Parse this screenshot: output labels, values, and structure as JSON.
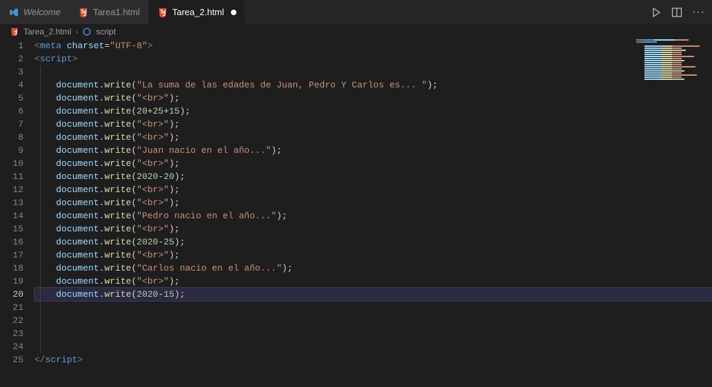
{
  "tabs": {
    "welcome": "Welcome",
    "tarea1": "Tarea1.html",
    "tarea2": "Tarea_2.html"
  },
  "breadcrumb": {
    "file": "Tarea_2.html",
    "symbol": "script"
  },
  "editor_actions": {
    "run": "Run",
    "split": "Split Editor",
    "more": "More Actions"
  },
  "active_line": 20,
  "total_lines": 25,
  "code": {
    "l1": {
      "tag_open": "<",
      "tag_name": "meta",
      "attr": "charset",
      "eq": "=",
      "val": "\"UTF-8\"",
      "tag_close": ">"
    },
    "l2": {
      "open": "<",
      "name": "script",
      "close": ">"
    },
    "l4": {
      "obj": "document",
      "dot": ".",
      "fn": "write",
      "op": "(",
      "str": "\"La suma de las edades de Juan, Pedro Y Carlos es... \"",
      "cp": ")",
      "semi": ";"
    },
    "l5": {
      "obj": "document",
      "dot": ".",
      "fn": "write",
      "op": "(",
      "str": "\"<br>\"",
      "cp": ")",
      "semi": ";"
    },
    "l6": {
      "obj": "document",
      "dot": ".",
      "fn": "write",
      "op": "(",
      "n1": "20",
      "p1": "+",
      "n2": "25",
      "p2": "+",
      "n3": "15",
      "cp": ")",
      "semi": ";"
    },
    "l7": {
      "obj": "document",
      "dot": ".",
      "fn": "write",
      "op": "(",
      "str": "\"<br>\"",
      "cp": ")",
      "semi": ";"
    },
    "l8": {
      "obj": "document",
      "dot": ".",
      "fn": "write",
      "op": "(",
      "str": "\"<br>\"",
      "cp": ")",
      "semi": ";"
    },
    "l9": {
      "obj": "document",
      "dot": ".",
      "fn": "write",
      "op": "(",
      "str": "\"Juan nacio en el año...\"",
      "cp": ")",
      "semi": ";"
    },
    "l10": {
      "obj": "document",
      "dot": ".",
      "fn": "write",
      "op": "(",
      "str": "\"<br>\"",
      "cp": ")",
      "semi": ";"
    },
    "l11": {
      "obj": "document",
      "dot": ".",
      "fn": "write",
      "op": "(",
      "n1": "2020",
      "p1": "-",
      "n2": "20",
      "cp": ")",
      "semi": ";"
    },
    "l12": {
      "obj": "document",
      "dot": ".",
      "fn": "write",
      "op": "(",
      "str": "\"<br>\"",
      "cp": ")",
      "semi": ";"
    },
    "l13": {
      "obj": "document",
      "dot": ".",
      "fn": "write",
      "op": "(",
      "str": "\"<br>\"",
      "cp": ")",
      "semi": ";"
    },
    "l14": {
      "obj": "document",
      "dot": ".",
      "fn": "write",
      "op": "(",
      "str": "\"Pedro nacio en el año...\"",
      "cp": ")",
      "semi": ";"
    },
    "l15": {
      "obj": "document",
      "dot": ".",
      "fn": "write",
      "op": "(",
      "str": "\"<br>\"",
      "cp": ")",
      "semi": ";"
    },
    "l16": {
      "obj": "document",
      "dot": ".",
      "fn": "write",
      "op": "(",
      "n1": "2020",
      "p1": "-",
      "n2": "25",
      "cp": ")",
      "semi": ";"
    },
    "l17": {
      "obj": "document",
      "dot": ".",
      "fn": "write",
      "op": "(",
      "str": "\"<br>\"",
      "cp": ")",
      "semi": ";"
    },
    "l18": {
      "obj": "document",
      "dot": ".",
      "fn": "write",
      "op": "(",
      "str": "\"Carlos nacio en el año...\"",
      "cp": ")",
      "semi": ";"
    },
    "l19": {
      "obj": "document",
      "dot": ".",
      "fn": "write",
      "op": "(",
      "str": "\"<br>\"",
      "cp": ")",
      "semi": ";"
    },
    "l20": {
      "obj": "document",
      "dot": ".",
      "fn": "write",
      "op": "(",
      "n1": "2020",
      "p1": "-",
      "n2": "15",
      "cp": ")",
      "semi": ";"
    },
    "l25": {
      "open": "</",
      "name": "script",
      "close": ">"
    }
  }
}
